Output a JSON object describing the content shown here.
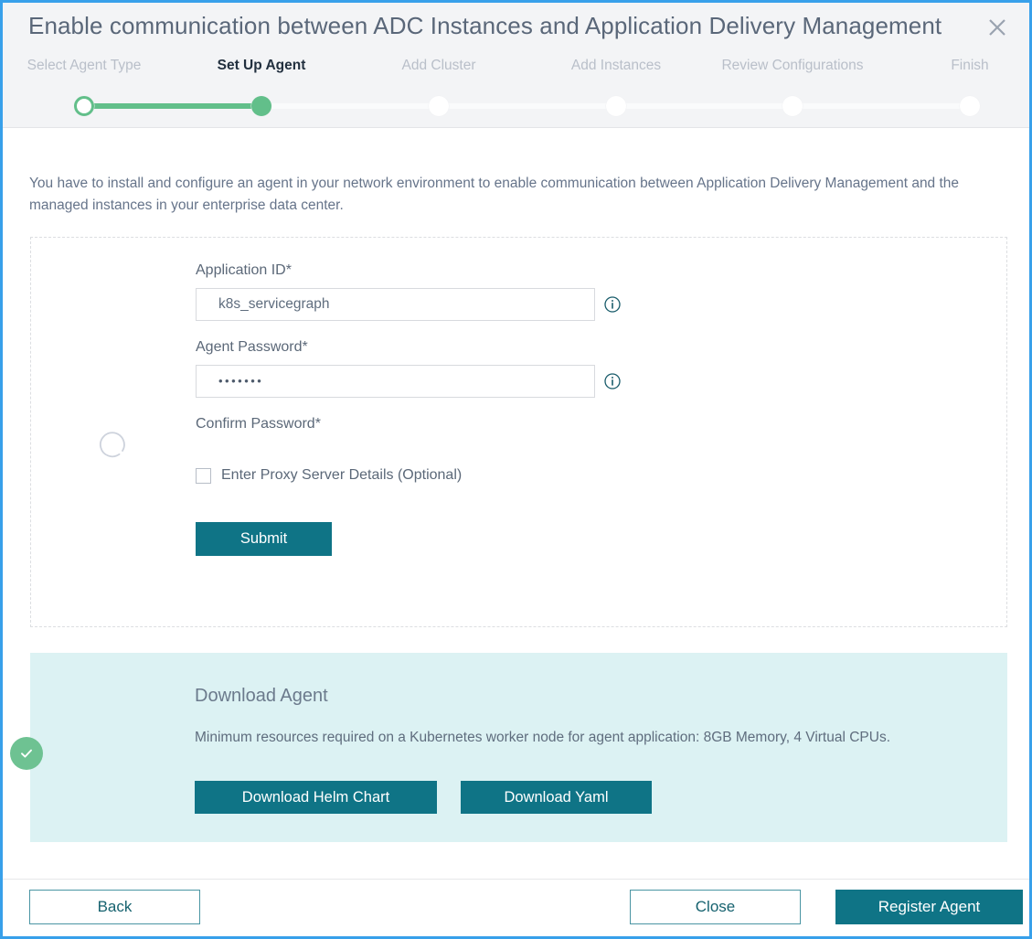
{
  "window": {
    "title": "Enable communication between ADC Instances and Application Delivery Management",
    "close_icon": "close-icon",
    "border_color": "#38a0ea"
  },
  "stepper": {
    "steps": [
      {
        "label": "Select Agent Type",
        "state": "completed"
      },
      {
        "label": "Set Up Agent",
        "state": "current"
      },
      {
        "label": "Add Cluster",
        "state": "upcoming"
      },
      {
        "label": "Add Instances",
        "state": "upcoming"
      },
      {
        "label": "Review Configurations",
        "state": "upcoming"
      },
      {
        "label": "Finish",
        "state": "upcoming"
      }
    ],
    "progress_color": "#62bf8a"
  },
  "intro": {
    "text": "You have to install and configure an agent in your network environment to enable communication between Application Delivery Management and the managed instances in your enterprise data center."
  },
  "form": {
    "spinner_icon": "loading-spinner-icon",
    "application_id": {
      "label": "Application ID*",
      "value": "k8s_servicegraph",
      "placeholder": "",
      "info_icon": "info-icon"
    },
    "agent_password": {
      "label": "Agent Password*",
      "value": "•••••••",
      "info_icon": "info-icon"
    },
    "confirm_password": {
      "label": "Confirm Password*"
    },
    "proxy_checkbox": {
      "label": "Enter Proxy Server Details (Optional)",
      "checked": false
    },
    "submit_label": "Submit"
  },
  "download": {
    "status_icon": "check-circle-icon",
    "title": "Download Agent",
    "description": "Minimum resources required on a Kubernetes worker node for agent application: 8GB Memory, 4 Virtual CPUs.",
    "helm_label": "Download Helm Chart",
    "yaml_label": "Download Yaml",
    "panel_color": "#dcf2f3",
    "accent_color": "#0f7486"
  },
  "footer": {
    "back_label": "Back",
    "close_label": "Close",
    "register_label": "Register Agent"
  }
}
